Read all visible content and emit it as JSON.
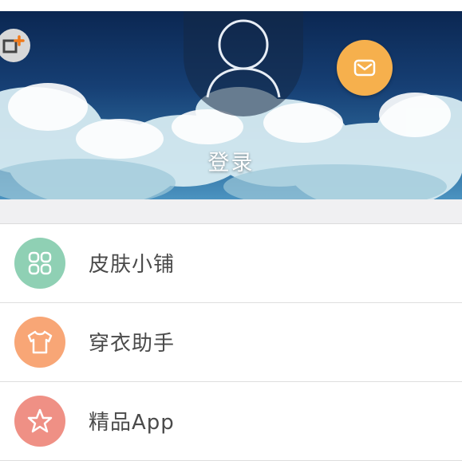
{
  "header": {
    "login_label": "登录"
  },
  "menu": {
    "items": [
      {
        "label": "皮肤小铺",
        "icon": "skin-shop-icon",
        "color": "#8fd0b4"
      },
      {
        "label": "穿衣助手",
        "icon": "shirt-icon",
        "color": "#f8a676"
      },
      {
        "label": "精品App",
        "icon": "star-icon",
        "color": "#ef9085"
      }
    ]
  },
  "colors": {
    "mail_button": "#f6b04d",
    "sky_dark": "#0b2752",
    "background": "#f3f3f5"
  }
}
